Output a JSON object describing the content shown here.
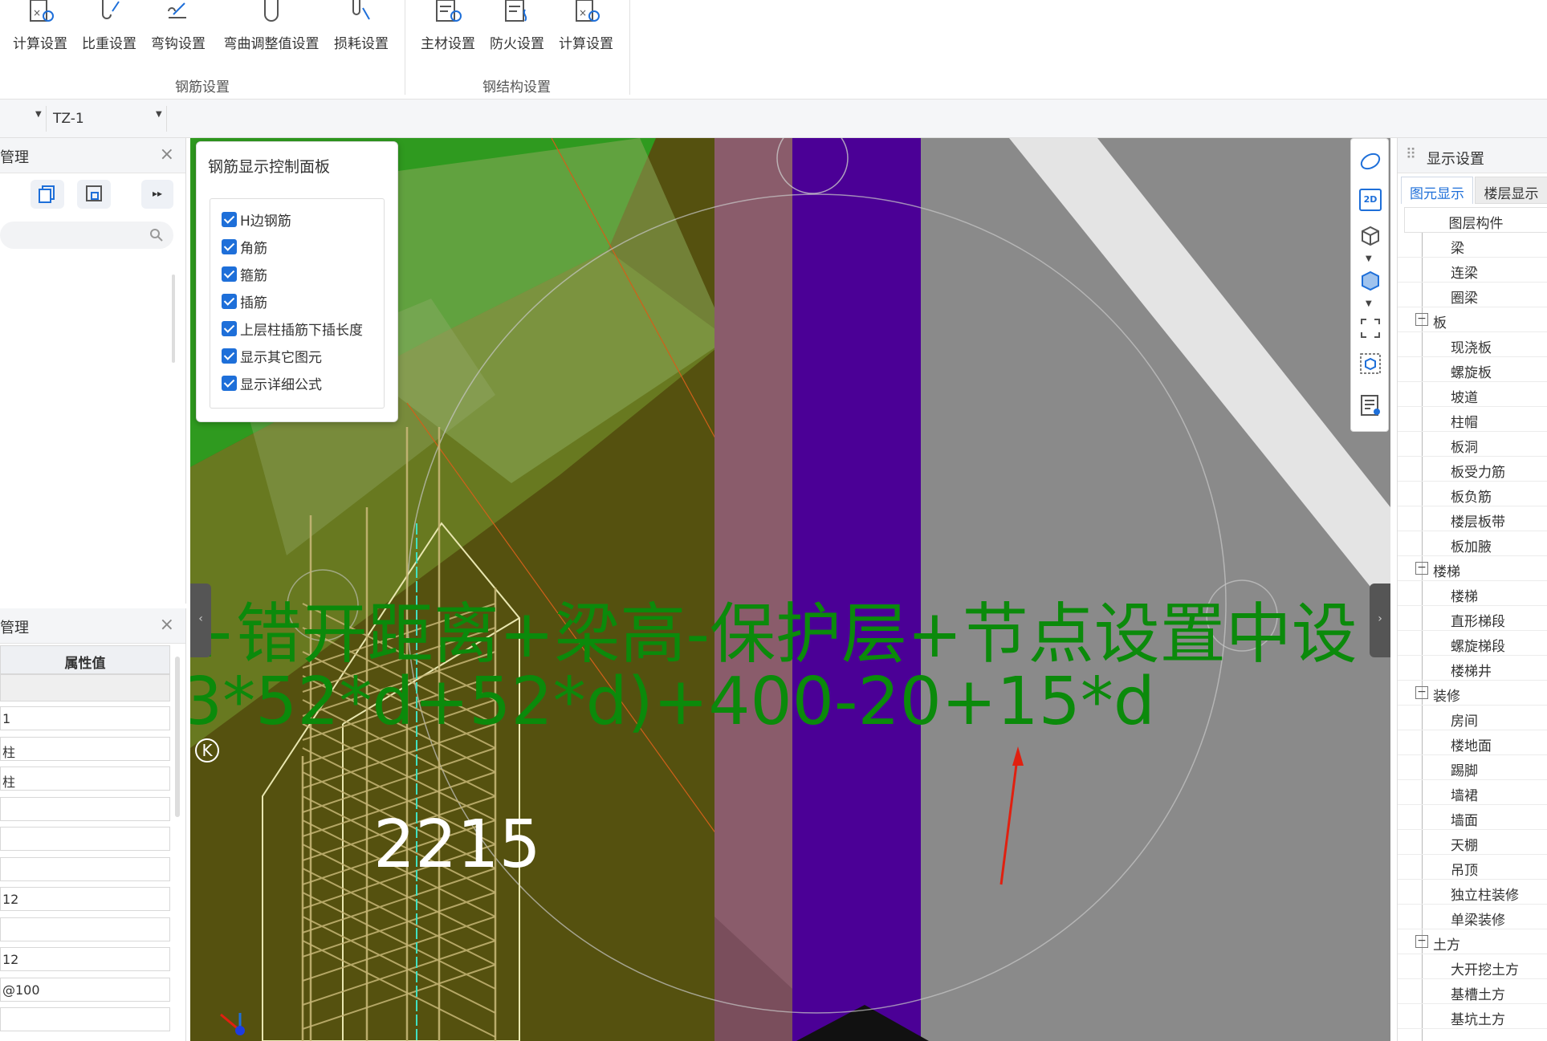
{
  "ribbon": {
    "rebar_buttons": [
      {
        "label": "计算设置",
        "icon": "calc-settings-icon"
      },
      {
        "label": "比重设置",
        "icon": "density-settings-icon"
      },
      {
        "label": "弯钩设置",
        "icon": "hook-settings-icon"
      },
      {
        "label": "弯曲调整值设置",
        "icon": "bend-adjust-icon"
      },
      {
        "label": "损耗设置",
        "icon": "loss-settings-icon"
      }
    ],
    "rebar_group": "钢筋设置",
    "steel_buttons": [
      {
        "label": "主材设置",
        "icon": "material-settings-icon"
      },
      {
        "label": "防火设置",
        "icon": "fire-settings-icon"
      },
      {
        "label": "计算设置",
        "icon": "calc-settings-icon"
      }
    ],
    "steel_group": "钢结构设置"
  },
  "selectors": {
    "component": "TZ-1"
  },
  "left_top_panel": {
    "title": "管理",
    "close": "×",
    "toolbar_more": "▸▸"
  },
  "left_bottom_panel": {
    "title": "管理",
    "close": "×",
    "header": "属性值",
    "values": [
      "",
      "1",
      "柱",
      "柱",
      "",
      "",
      "",
      "12",
      "",
      "12",
      "@100",
      ""
    ]
  },
  "control_panel": {
    "title": "钢筋显示控制面板",
    "options": [
      {
        "label": "H边钢筋",
        "checked": true
      },
      {
        "label": "角筋",
        "checked": true
      },
      {
        "label": "箍筋",
        "checked": true
      },
      {
        "label": "插筋",
        "checked": true
      },
      {
        "label": "上层柱插筋下插长度",
        "checked": true
      },
      {
        "label": "显示其它图元",
        "checked": true
      },
      {
        "label": "显示详细公式",
        "checked": true
      }
    ]
  },
  "viewport": {
    "formula_line1": "+错开距离+梁高-保护层+节点设置中设",
    "formula_line2": "3*52*d+52*d)+400-20+15*d",
    "dimension": "2215",
    "axis_marker": "K",
    "colors": {
      "background": "#55510f",
      "formula": "#0b8a0b",
      "purple_wall": "#4b0096",
      "pink_wall": "#8a5c6b",
      "gray_wall": "#8a8a8a",
      "arrow": "#e02010"
    }
  },
  "right_panel": {
    "title": "显示设置",
    "tabs": [
      "图元显示",
      "楼层显示"
    ],
    "header": "图层构件",
    "tree": [
      {
        "label": "梁",
        "level": 2
      },
      {
        "label": "连梁",
        "level": 2
      },
      {
        "label": "圈梁",
        "level": 2
      },
      {
        "label": "板",
        "level": 1
      },
      {
        "label": "现浇板",
        "level": 2
      },
      {
        "label": "螺旋板",
        "level": 2
      },
      {
        "label": "坡道",
        "level": 2
      },
      {
        "label": "柱帽",
        "level": 2
      },
      {
        "label": "板洞",
        "level": 2
      },
      {
        "label": "板受力筋",
        "level": 2
      },
      {
        "label": "板负筋",
        "level": 2
      },
      {
        "label": "楼层板带",
        "level": 2
      },
      {
        "label": "板加腋",
        "level": 2
      },
      {
        "label": "楼梯",
        "level": 1
      },
      {
        "label": "楼梯",
        "level": 2
      },
      {
        "label": "直形梯段",
        "level": 2
      },
      {
        "label": "螺旋梯段",
        "level": 2
      },
      {
        "label": "楼梯井",
        "level": 2
      },
      {
        "label": "装修",
        "level": 1
      },
      {
        "label": "房间",
        "level": 2
      },
      {
        "label": "楼地面",
        "level": 2
      },
      {
        "label": "踢脚",
        "level": 2
      },
      {
        "label": "墙裙",
        "level": 2
      },
      {
        "label": "墙面",
        "level": 2
      },
      {
        "label": "天棚",
        "level": 2
      },
      {
        "label": "吊顶",
        "level": 2
      },
      {
        "label": "独立柱装修",
        "level": 2
      },
      {
        "label": "单梁装修",
        "level": 2
      },
      {
        "label": "土方",
        "level": 1
      },
      {
        "label": "大开挖土方",
        "level": 2
      },
      {
        "label": "基槽土方",
        "level": 2
      },
      {
        "label": "基坑土方",
        "level": 2
      }
    ]
  },
  "view_toolbar": {
    "icons": [
      "rotate-view-icon",
      "2d-view-icon",
      "3d-box-icon",
      "solid-box-icon",
      "fit-frame-icon",
      "view-cube-icon",
      "display-list-icon"
    ],
    "label_2d": "2D"
  }
}
